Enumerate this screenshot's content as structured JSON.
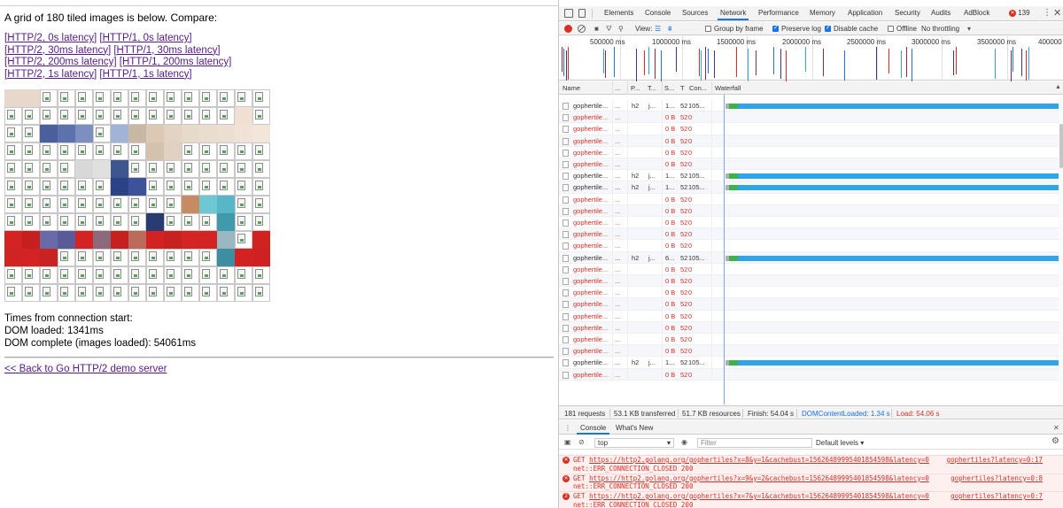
{
  "page": {
    "intro": "A grid of 180 tiled images is below. Compare:",
    "links": [
      [
        "[HTTP/2, 0s latency]",
        "[HTTP/1, 0s latency]"
      ],
      [
        "[HTTP/2, 30ms latency]",
        "[HTTP/1, 30ms latency]"
      ],
      [
        "[HTTP/2, 200ms latency]",
        "[HTTP/1, 200ms latency]"
      ],
      [
        "[HTTP/2, 1s latency]",
        "[HTTP/1, 1s latency]"
      ]
    ],
    "times_title": "Times from connection start:",
    "dom_loaded": "DOM loaded: 1341ms",
    "dom_complete": "DOM complete (images loaded): 54061ms",
    "back_link": "<< Back to Go HTTP/2 demo server"
  },
  "devtools": {
    "tabs": [
      "Elements",
      "Console",
      "Sources",
      "Network",
      "Performance",
      "Memory",
      "Application",
      "Security",
      "Audits",
      "AdBlock"
    ],
    "active_tab": "Network",
    "error_count": "139",
    "toolbar": {
      "view": "View:",
      "group_by_frame": "Group by frame",
      "preserve_log": "Preserve log",
      "disable_cache": "Disable cache",
      "offline": "Offline",
      "throttling": "No throttling"
    },
    "overview_ticks": [
      "500000 ms",
      "1000000 ms",
      "1500000 ms",
      "2000000 ms",
      "2500000 ms",
      "3000000 ms",
      "3500000 ms",
      "400000"
    ],
    "columns": [
      "Name",
      "...",
      "P...",
      "T...",
      "S...",
      "T",
      "Con...",
      "Waterfall"
    ],
    "rows": [
      {
        "name": "gophertile...",
        "dots": "...",
        "proto": "h2",
        "type": "j...",
        "size": "1...",
        "t": "52",
        "con": "105...",
        "ok": true
      },
      {
        "name": "gophertile...",
        "dots": "...",
        "proto": "",
        "type": "",
        "size": "0 B",
        "t": "52",
        "con": "0",
        "ok": false
      },
      {
        "name": "gophertile...",
        "dots": "...",
        "proto": "",
        "type": "",
        "size": "0 B",
        "t": "52",
        "con": "0",
        "ok": false
      },
      {
        "name": "gophertile...",
        "dots": "...",
        "proto": "",
        "type": "",
        "size": "0 B",
        "t": "52",
        "con": "0",
        "ok": false
      },
      {
        "name": "gophertile...",
        "dots": "...",
        "proto": "",
        "type": "",
        "size": "0 B",
        "t": "52",
        "con": "0",
        "ok": false
      },
      {
        "name": "gophertile...",
        "dots": "...",
        "proto": "",
        "type": "",
        "size": "0 B",
        "t": "52",
        "con": "0",
        "ok": false
      },
      {
        "name": "gophertile...",
        "dots": "...",
        "proto": "h2",
        "type": "j...",
        "size": "1...",
        "t": "52",
        "con": "105...",
        "ok": true
      },
      {
        "name": "gophertile...",
        "dots": "...",
        "proto": "h2",
        "type": "j...",
        "size": "1...",
        "t": "52",
        "con": "105...",
        "ok": true
      },
      {
        "name": "gophertile...",
        "dots": "...",
        "proto": "",
        "type": "",
        "size": "0 B",
        "t": "52",
        "con": "0",
        "ok": false
      },
      {
        "name": "gophertile...",
        "dots": "...",
        "proto": "",
        "type": "",
        "size": "0 B",
        "t": "52",
        "con": "0",
        "ok": false
      },
      {
        "name": "gophertile...",
        "dots": "...",
        "proto": "",
        "type": "",
        "size": "0 B",
        "t": "52",
        "con": "0",
        "ok": false
      },
      {
        "name": "gophertile...",
        "dots": "...",
        "proto": "",
        "type": "",
        "size": "0 B",
        "t": "52",
        "con": "0",
        "ok": false
      },
      {
        "name": "gophertile...",
        "dots": "...",
        "proto": "",
        "type": "",
        "size": "0 B",
        "t": "52",
        "con": "0",
        "ok": false
      },
      {
        "name": "gophertile...",
        "dots": "...",
        "proto": "h2",
        "type": "j...",
        "size": "6...",
        "t": "52",
        "con": "105...",
        "ok": true
      },
      {
        "name": "gophertile...",
        "dots": "...",
        "proto": "",
        "type": "",
        "size": "0 B",
        "t": "52",
        "con": "0",
        "ok": false
      },
      {
        "name": "gophertile...",
        "dots": "...",
        "proto": "",
        "type": "",
        "size": "0 B",
        "t": "52",
        "con": "0",
        "ok": false
      },
      {
        "name": "gophertile...",
        "dots": "...",
        "proto": "",
        "type": "",
        "size": "0 B",
        "t": "52",
        "con": "0",
        "ok": false
      },
      {
        "name": "gophertile...",
        "dots": "...",
        "proto": "",
        "type": "",
        "size": "0 B",
        "t": "52",
        "con": "0",
        "ok": false
      },
      {
        "name": "gophertile...",
        "dots": "...",
        "proto": "",
        "type": "",
        "size": "0 B",
        "t": "52",
        "con": "0",
        "ok": false
      },
      {
        "name": "gophertile...",
        "dots": "...",
        "proto": "",
        "type": "",
        "size": "0 B",
        "t": "52",
        "con": "0",
        "ok": false
      },
      {
        "name": "gophertile...",
        "dots": "...",
        "proto": "",
        "type": "",
        "size": "0 B",
        "t": "52",
        "con": "0",
        "ok": false
      },
      {
        "name": "gophertile...",
        "dots": "...",
        "proto": "",
        "type": "",
        "size": "0 B",
        "t": "52",
        "con": "0",
        "ok": false
      },
      {
        "name": "gophertile...",
        "dots": "...",
        "proto": "h2",
        "type": "j...",
        "size": "1...",
        "t": "52",
        "con": "105...",
        "ok": true
      },
      {
        "name": "gophertile...",
        "dots": "...",
        "proto": "",
        "type": "",
        "size": "0 B",
        "t": "52",
        "con": "0",
        "ok": false
      }
    ],
    "status": {
      "requests": "181 requests",
      "transferred": "53.1 KB transferred",
      "resources": "51.7 KB resources",
      "finish": "Finish: 54.04 s",
      "dom_content_loaded": "DOMContentLoaded: 1.34 s",
      "load": "Load: 54.06 s"
    },
    "drawer_tabs": [
      "Console",
      "What's New"
    ],
    "console_context": "top",
    "filter_placeholder": "Filter",
    "levels": "Default levels ▾",
    "messages": [
      {
        "method": "GET",
        "url": "https://http2.golang.org/gophertiles?x=8&y=1&cachebust=15626489995401854598&latency=0",
        "error": "net::ERR_CONNECTION_CLOSED 200",
        "source": "gophertiles?latency=0:17",
        "count": ""
      },
      {
        "method": "GET",
        "url": "https://http2.golang.org/gophertiles?x=9&y=2&cachebust=15626489995401854598&latency=0",
        "error": "net::ERR_CONNECTION_CLOSED 200",
        "source": "gophertiles?latency=0:8",
        "count": ""
      },
      {
        "method": "GET",
        "url": "https://http2.golang.org/gophertiles?x=7&y=1&cachebust=15626489995401854598&latency=0",
        "error": "net::ERR_CONNECTION_CLOSED 200",
        "source": "gophertiles?latency=0:7",
        "count": "2"
      }
    ]
  },
  "colors": {
    "accent": "#1a73e8",
    "error": "#d93025",
    "link": "#551a8b",
    "waterfall": "#2da5e8",
    "waterfall_wait": "#3cb34a"
  }
}
